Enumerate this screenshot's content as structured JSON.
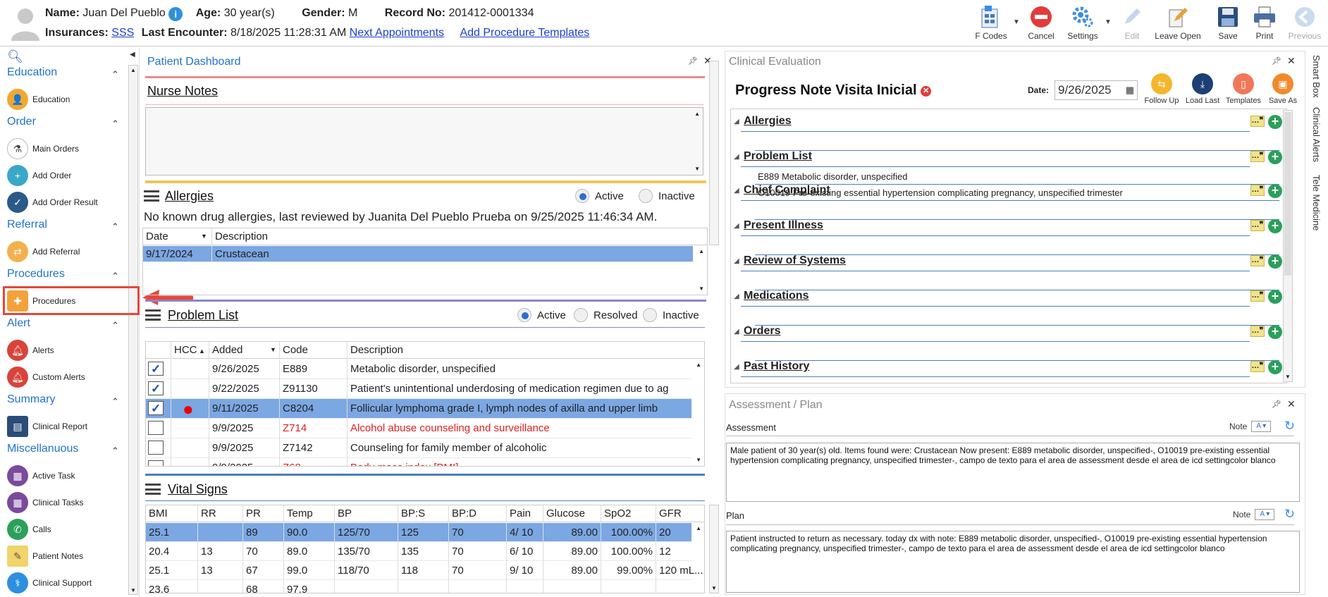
{
  "patient": {
    "name_label": "Name:",
    "name": "Juan Del Pueblo",
    "age_label": "Age:",
    "age": "30 year(s)",
    "gender_label": "Gender:",
    "gender": "M",
    "record_label": "Record No:",
    "record": "201412-0001334",
    "insurances_label": "Insurances:",
    "insurance": "SSS",
    "last_encounter_label": "Last Encounter:",
    "last_encounter": "8/18/2025 11:28:31 AM",
    "next_appointments": "Next Appointments",
    "add_procedure_templates": "Add Procedure Templates"
  },
  "toolbar": {
    "fcodes": "F Codes",
    "cancel": "Cancel",
    "settings": "Settings",
    "edit": "Edit",
    "leave_open": "Leave Open",
    "save": "Save",
    "print": "Print",
    "previous": "Previous"
  },
  "sidebar": {
    "sections": [
      {
        "title": "Education",
        "items": [
          "Education"
        ]
      },
      {
        "title": "Order",
        "items": [
          "Main Orders",
          "Add Order",
          "Add Order Result"
        ]
      },
      {
        "title": "Referral",
        "items": [
          "Add Referral"
        ]
      },
      {
        "title": "Procedures",
        "items": [
          "Procedures"
        ]
      },
      {
        "title": "Alert",
        "items": [
          "Alerts",
          "Custom Alerts"
        ]
      },
      {
        "title": "Summary",
        "items": [
          "Clinical Report"
        ]
      },
      {
        "title": "Miscellanuous",
        "items": [
          "Active Task",
          "Clinical Tasks",
          "Calls",
          "Patient Notes",
          "Clinical Support"
        ]
      }
    ]
  },
  "dashboard": {
    "title": "Patient Dashboard",
    "nurse_notes": "Nurse Notes",
    "allergies": {
      "title": "Allergies",
      "active": "Active",
      "inactive": "Inactive",
      "summary": "No known drug allergies, last reviewed by Juanita Del Pueblo Prueba on 9/25/2025 11:46:34 AM.",
      "columns": [
        "Date",
        "Description"
      ],
      "rows": [
        [
          "9/17/2024",
          "Crustacean"
        ]
      ]
    },
    "problem_list": {
      "title": "Problem List",
      "active": "Active",
      "resolved": "Resolved",
      "inactive": "Inactive",
      "columns": [
        "HCC",
        "Added",
        "Code",
        "Description"
      ],
      "rows": [
        {
          "checked": true,
          "hcc": "",
          "added": "9/26/2025",
          "code": "E889",
          "desc": "Metabolic disorder, unspecified",
          "red": false
        },
        {
          "checked": true,
          "hcc": "",
          "added": "9/22/2025",
          "code": "Z91130",
          "desc": "Patient's unintentional underdosing of medication regimen due to ag",
          "red": false
        },
        {
          "checked": true,
          "hcc": "●",
          "added": "9/11/2025",
          "code": "C8204",
          "desc": "Follicular lymphoma grade I, lymph nodes of axilla and upper limb",
          "red": false
        },
        {
          "checked": false,
          "hcc": "",
          "added": "9/9/2025",
          "code": "Z714",
          "desc": "Alcohol abuse counseling and surveillance",
          "red": true
        },
        {
          "checked": false,
          "hcc": "",
          "added": "9/9/2025",
          "code": "Z7142",
          "desc": "Counseling for family member of alcoholic",
          "red": false
        },
        {
          "checked": false,
          "hcc": "",
          "added": "9/9/2025",
          "code": "Z68",
          "desc": "Body mass index [BMI]",
          "red": true
        }
      ]
    },
    "vital_signs": {
      "title": "Vital Signs",
      "columns": [
        "BMI",
        "RR",
        "PR",
        "Temp",
        "BP",
        "BP:S",
        "BP:D",
        "Pain",
        "Glucose",
        "SpO2",
        "GFR"
      ],
      "rows": [
        [
          "25.1",
          "",
          "89",
          "90.0",
          "125/70",
          "125",
          "70",
          "4/ 10",
          "89.00",
          "100.00%",
          "20"
        ],
        [
          "20.4",
          "13",
          "70",
          "89.0",
          "135/70",
          "135",
          "70",
          "6/ 10",
          "89.00",
          "100.00%",
          "12"
        ],
        [
          "25.1",
          "13",
          "67",
          "99.0",
          "118/70",
          "118",
          "70",
          "9/ 10",
          "89.00",
          "99.00%",
          "120 mL..."
        ],
        [
          "23.6",
          "",
          "68",
          "97.9",
          "",
          "",
          "",
          "",
          "",
          "",
          ""
        ]
      ]
    }
  },
  "clinical_eval": {
    "title": "Clinical Evaluation",
    "note_title": "Progress Note Visita Inicial",
    "date_label": "Date:",
    "date": "9/26/2025",
    "buttons": [
      "Follow Up",
      "Load Last",
      "Templates",
      "Save As"
    ],
    "sections": [
      {
        "label": "Allergies",
        "items": []
      },
      {
        "label": "Problem List",
        "items": [
          "E889 Metabolic disorder, unspecified",
          "O10019 Pre-existing essential hypertension complicating pregnancy, unspecified trimester"
        ]
      },
      {
        "label": "Chief Complaint",
        "items": []
      },
      {
        "label": "Present Illness",
        "items": []
      },
      {
        "label": "Review of Systems",
        "items": []
      },
      {
        "label": "Medications",
        "items": []
      },
      {
        "label": "Orders",
        "items": []
      },
      {
        "label": "Past History",
        "items": []
      }
    ],
    "side_tabs": [
      "Smart Box",
      "Clinical Alerts",
      "Tele Medicine"
    ]
  },
  "assessment_plan": {
    "title": "Assessment / Plan",
    "assessment_label": "Assessment",
    "plan_label": "Plan",
    "note_label": "Note",
    "assessment_text": "Male patient of 30 year(s) old. Items found were:  Crustacean  Now present: E889 metabolic disorder, unspecified-, O10019 pre-existing essential hypertension complicating pregnancy, unspecified trimester-,  campo de texto para el area de assessment desde el area de icd settingcolor blanco",
    "plan_text": "  Patient instructed to return as necessary.  today dx with note: E889 metabolic disorder, unspecified-, O10019 pre-existing essential hypertension complicating pregnancy, unspecified trimester-,  campo de texto para el area de assessment desde el area de icd settingcolor blanco"
  },
  "colors": {
    "accent": "#2174c9",
    "selection": "#7ba7e3",
    "highlight_box": "#e8463a",
    "alert_red": "#e02020"
  }
}
